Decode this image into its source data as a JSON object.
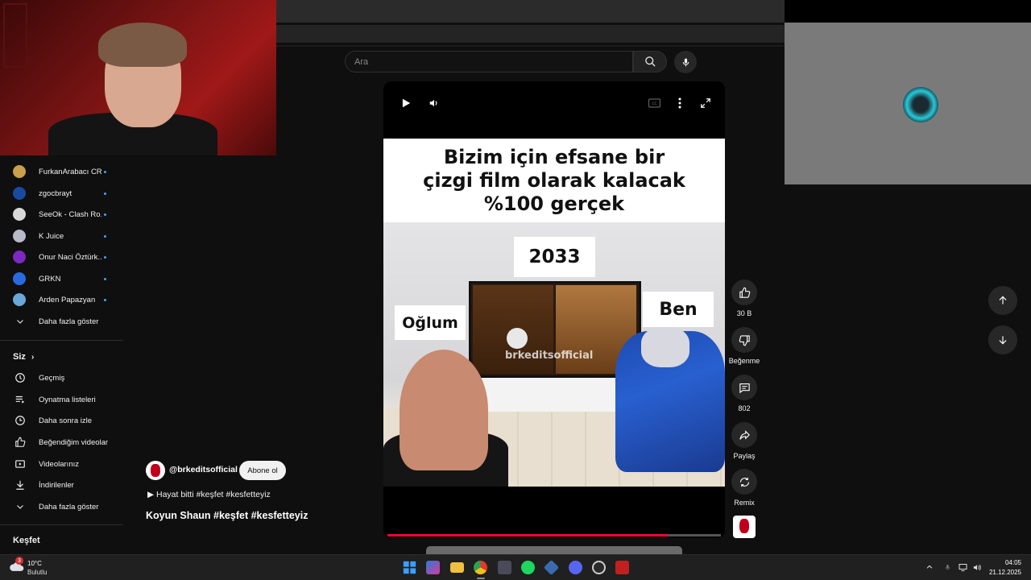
{
  "search": {
    "placeholder": "Ara"
  },
  "subscriptions": [
    {
      "name": "FurkanArabacı CR",
      "color": "#c9a04a"
    },
    {
      "name": "zgocbrayt",
      "color": "#1a4aa0"
    },
    {
      "name": "SeeOk - Clash Ro...",
      "color": "#d8d8d8"
    },
    {
      "name": "K Juice",
      "color": "#b8b8c8"
    },
    {
      "name": "Onur Naci Öztürk...",
      "color": "#7a2ac0"
    },
    {
      "name": "GRKN",
      "color": "#2a6ae0"
    },
    {
      "name": "Arden Papazyan",
      "color": "#6aa8d8"
    }
  ],
  "sidebar": {
    "show_more_1": "Daha fazla göster",
    "you_title": "Siz",
    "you_items": [
      "Geçmiş",
      "Oynatma listeleri",
      "Daha sonra izle",
      "Beğendiğim videolar",
      "Videolarınız",
      "İndirilenler"
    ],
    "show_more_2": "Daha fazla göster",
    "explore_title": "Keşfet"
  },
  "video": {
    "overlay_lines": [
      "Bizim için efsane bir",
      "çizgi film olarak kalacak",
      "%100 gerçek"
    ],
    "label_year": "2033",
    "label_son": "Oğlum",
    "label_me": "Ben",
    "watermark": "brkeditsofficial",
    "progress": 0.84
  },
  "channel": {
    "handle": "@brkeditsofficial",
    "subscribe": "Abone ol",
    "description": "▶ Hayat bitti #keşfet #kesfetteyiz",
    "title": "Koyun Shaun #keşfet #kesfetteyiz"
  },
  "actions": {
    "likes": "30 B",
    "dislike": "Beğenme",
    "comments": "802",
    "share": "Paylaş",
    "remix": "Remix"
  },
  "taskbar": {
    "weather_temp": "10°C",
    "weather_cond": "Bulutlu",
    "weather_badge": "3",
    "time": "04:05",
    "date": "21.12.2025"
  }
}
